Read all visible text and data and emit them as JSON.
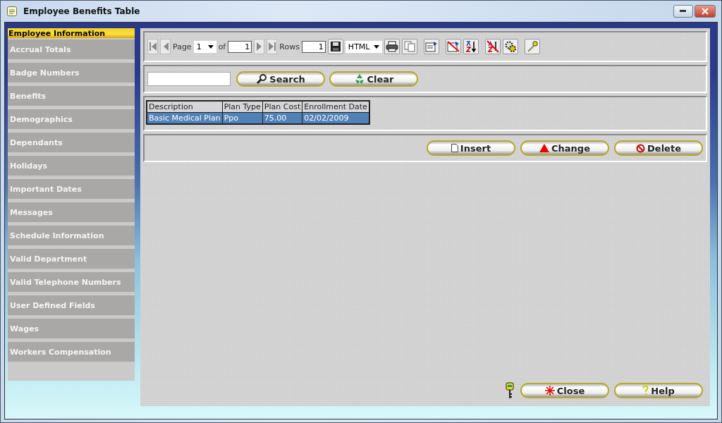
{
  "window": {
    "title": "Employee Benefits Table"
  },
  "sidebar": {
    "items": [
      {
        "label": "Employee Information",
        "selected": true
      },
      {
        "label": "Accrual Totals",
        "selected": false
      },
      {
        "label": "Badge Numbers",
        "selected": false
      },
      {
        "label": "Benefits",
        "selected": false
      },
      {
        "label": "Demographics",
        "selected": false
      },
      {
        "label": "Dependants",
        "selected": false
      },
      {
        "label": "Holidays",
        "selected": false
      },
      {
        "label": "Important Dates",
        "selected": false
      },
      {
        "label": "Messages",
        "selected": false
      },
      {
        "label": "Schedule Information",
        "selected": false
      },
      {
        "label": "Valid Department",
        "selected": false
      },
      {
        "label": "Valid Telephone Numbers",
        "selected": false
      },
      {
        "label": "User Defined Fields",
        "selected": false
      },
      {
        "label": "Wages",
        "selected": false
      },
      {
        "label": "Workers Compensation",
        "selected": false
      }
    ]
  },
  "toolbar": {
    "page_label": "Page",
    "page_value": "1",
    "of_label": "of",
    "total_pages": "1",
    "rows_label": "Rows",
    "rows_value": "1",
    "format": "HTML"
  },
  "search_bar": {
    "buttons": [
      {
        "label": "Search",
        "kind": "search"
      },
      {
        "label": "Clear",
        "kind": "clear"
      }
    ]
  },
  "table": {
    "columns": [
      "Description",
      "Plan Type",
      "Plan Cost",
      "Enrollment Date"
    ],
    "rows": [
      {
        "cells": [
          "Basic Medical Plan",
          "Ppo",
          "75.00",
          "02/02/2009"
        ],
        "selected": true
      }
    ]
  },
  "actions": [
    {
      "label": "Insert",
      "kind": "insert"
    },
    {
      "label": "Change",
      "kind": "change"
    },
    {
      "label": "Delete",
      "kind": "delete"
    }
  ],
  "footer": [
    {
      "label": "Close",
      "kind": "close"
    },
    {
      "label": "Help",
      "kind": "help"
    }
  ]
}
